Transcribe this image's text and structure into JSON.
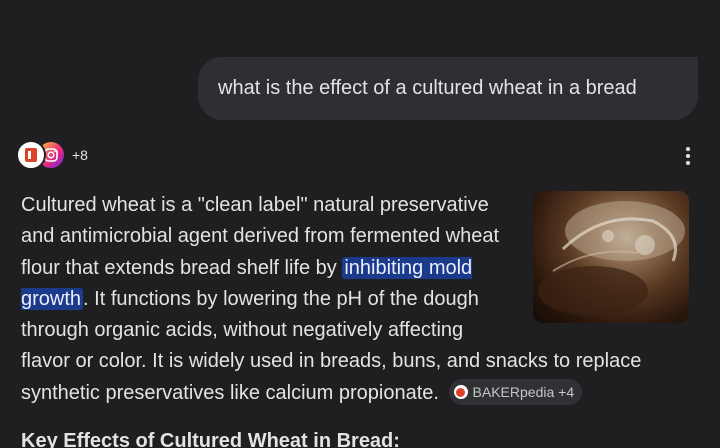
{
  "user_query": "what is the effect of a cultured wheat in a bread",
  "sources": {
    "more_count": "+8",
    "icons": [
      "bakerpedia-icon",
      "instagram-icon"
    ]
  },
  "more_options_icon": "more-vert-icon",
  "answer": {
    "part1": "Cultured wheat is a \"clean label\" natural preservative and antimicrobial agent derived from fermented wheat flour that extends bread shelf life by ",
    "highlight": "inhibiting mold growth",
    "part2": ". It functions by lowering the pH of the dough through organic acids, without negatively affecting flavor or color. It is widely used in breads, buns, and snacks to replace synthetic preservatives like calcium propionate.",
    "citation": "BAKERpedia +4"
  },
  "section_heading": "Key Effects of Cultured Wheat in Bread:",
  "colors": {
    "background": "#1f1f22",
    "bubble": "#2e2f33",
    "highlight": "#1c3a8a",
    "text": "#e3e3e3"
  }
}
